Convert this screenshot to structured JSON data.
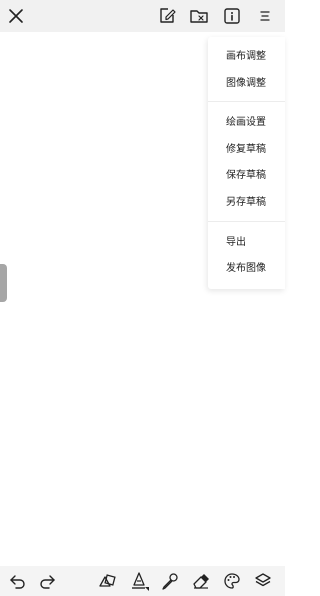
{
  "top_bar": {
    "icons": [
      "close-icon",
      "document-edit-icon",
      "folder-icon",
      "info-icon",
      "menu-icon"
    ]
  },
  "menu": {
    "groups": [
      [
        "画布调整",
        "图像调整"
      ],
      [
        "绘画设置",
        "修复草稿",
        "保存草稿",
        "另存草稿"
      ],
      [
        "导出",
        "发布图像"
      ]
    ]
  },
  "bottom_bar": {
    "icons": [
      "undo-icon",
      "redo-icon",
      "shapes-icon",
      "pen-icon",
      "eyedropper-icon",
      "eraser-icon",
      "palette-icon",
      "layers-icon"
    ]
  },
  "colors": {
    "bar_background": "#f1f1f1",
    "icon_color": "#222222",
    "handle": "#a6a6a6"
  }
}
